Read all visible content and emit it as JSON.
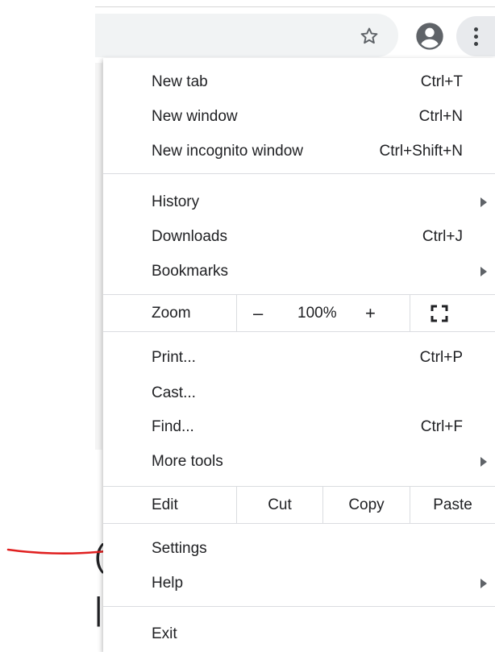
{
  "toolbar": {
    "star_icon": "star-outline-icon",
    "account_icon": "account-circle-icon",
    "menu_icon": "vertical-dots-icon"
  },
  "menu": {
    "group1": [
      {
        "label": "New tab",
        "shortcut": "Ctrl+T"
      },
      {
        "label": "New window",
        "shortcut": "Ctrl+N"
      },
      {
        "label": "New incognito window",
        "shortcut": "Ctrl+Shift+N"
      }
    ],
    "group2": [
      {
        "label": "History",
        "shortcut": "",
        "submenu": true
      },
      {
        "label": "Downloads",
        "shortcut": "Ctrl+J"
      },
      {
        "label": "Bookmarks",
        "shortcut": "",
        "submenu": true
      }
    ],
    "zoom": {
      "label": "Zoom",
      "minus": "–",
      "level": "100%",
      "plus": "+",
      "fullscreen_icon": "fullscreen-icon"
    },
    "group3": [
      {
        "label": "Print...",
        "shortcut": "Ctrl+P"
      },
      {
        "label": "Cast...",
        "shortcut": ""
      },
      {
        "label": "Find...",
        "shortcut": "Ctrl+F"
      },
      {
        "label": "More tools",
        "shortcut": "",
        "submenu": true
      }
    ],
    "edit": {
      "label": "Edit",
      "cut": "Cut",
      "copy": "Copy",
      "paste": "Paste"
    },
    "group4": [
      {
        "label": "Settings",
        "shortcut": ""
      },
      {
        "label": "Help",
        "shortcut": "",
        "submenu": true
      }
    ],
    "exit": {
      "label": "Exit"
    }
  },
  "annotation": {
    "color": "#e02020"
  },
  "colors": {
    "icon": "#5f6368",
    "divider": "#dadce0",
    "menu_button_bg": "#e8eaed",
    "omnibox_bg": "#f1f3f4"
  }
}
